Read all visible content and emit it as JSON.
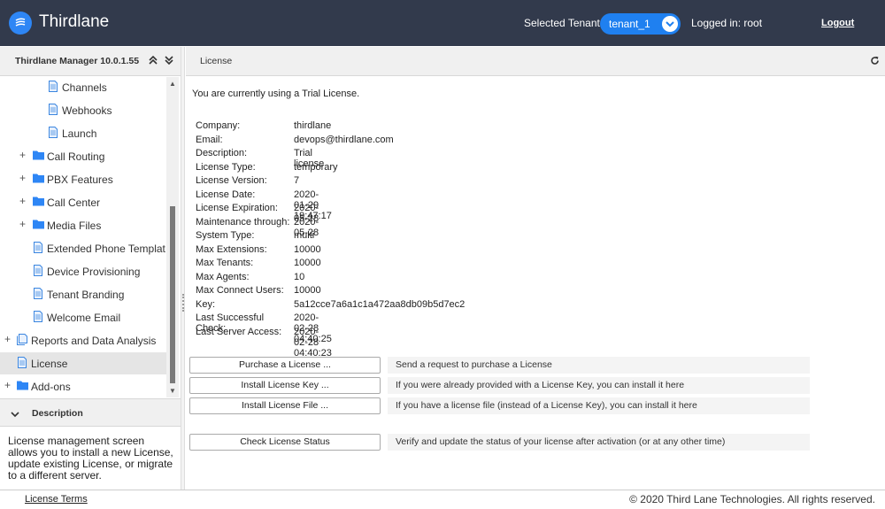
{
  "header": {
    "brand": "Thirdlane",
    "tenant_label": "Selected Tenant :",
    "tenant_value": "tenant_1",
    "logged_in": "Logged in: root",
    "logout": "Logout",
    "brand_color": "#323a4c",
    "accent_color": "#1f80f0"
  },
  "left": {
    "title": "Thirdlane Manager 10.0.1.55",
    "tree": [
      {
        "label": "Channels",
        "icon": "document-icon"
      },
      {
        "label": "Webhooks",
        "icon": "document-icon"
      },
      {
        "label": "Launch",
        "icon": "document-icon"
      },
      {
        "label": "Call Routing",
        "icon": "folder-icon"
      },
      {
        "label": "PBX Features",
        "icon": "folder-icon"
      },
      {
        "label": "Call Center",
        "icon": "folder-icon"
      },
      {
        "label": "Media Files",
        "icon": "folder-icon"
      },
      {
        "label": "Extended Phone Templat...",
        "icon": "document-icon"
      },
      {
        "label": "Device Provisioning",
        "icon": "document-icon"
      },
      {
        "label": "Tenant Branding",
        "icon": "document-icon"
      },
      {
        "label": "Welcome Email",
        "icon": "document-icon"
      },
      {
        "label": "Reports and Data Analysis",
        "icon": "documents-icon"
      },
      {
        "label": "License",
        "icon": "document-icon"
      },
      {
        "label": "Add-ons",
        "icon": "folder-icon"
      }
    ],
    "description_title": "Description",
    "description_text": "License management screen allows you to install a new License, update existing License, or migrate to a different server."
  },
  "main": {
    "title": "License",
    "trial_notice": "You are currently using a Trial License.",
    "info": [
      {
        "k": "Company:",
        "v": "thirdlane"
      },
      {
        "k": "Email:",
        "v": "devops@thirdlane.com"
      },
      {
        "k": "Description:",
        "v": "Trial license"
      },
      {
        "k": "License Type:",
        "v": "temporary"
      },
      {
        "k": "License Version:",
        "v": "7"
      },
      {
        "k": "License Date:",
        "v": "2020-01-29 19:47:17"
      },
      {
        "k": "License Expiration:",
        "v": "2020-05-28"
      },
      {
        "k": "Maintenance through:",
        "v": "2020-05-28"
      },
      {
        "k": "System Type:",
        "v": "multi"
      },
      {
        "k": "Max Extensions:",
        "v": "10000"
      },
      {
        "k": "Max Tenants:",
        "v": "10000"
      },
      {
        "k": "Max Agents:",
        "v": "10"
      },
      {
        "k": "Max Connect Users:",
        "v": "10000"
      },
      {
        "k": "Key:",
        "v": "5a12cce7a6a1c1a472aa8db09b5d7ec2"
      },
      {
        "k": "Last Successful Check:",
        "v": "2020-02-28 04:40:25"
      },
      {
        "k": "Last Server Access:",
        "v": "2020-02-28 04:40:23"
      }
    ],
    "actions": [
      {
        "label": "Purchase a License ...",
        "desc": "Send a request to purchase a License"
      },
      {
        "label": "Install License Key ...",
        "desc": "If you were already provided with a License Key, you can install it here"
      },
      {
        "label": "Install License File ...",
        "desc": "If you have a license file (instead of a License Key), you can install it here"
      },
      {
        "label": "Check License Status",
        "desc": "Verify and update the status of your license after activation (or at any other time)"
      }
    ]
  },
  "footer": {
    "terms": "License Terms",
    "copyright": "© 2020 Third Lane Technologies. All rights reserved."
  }
}
